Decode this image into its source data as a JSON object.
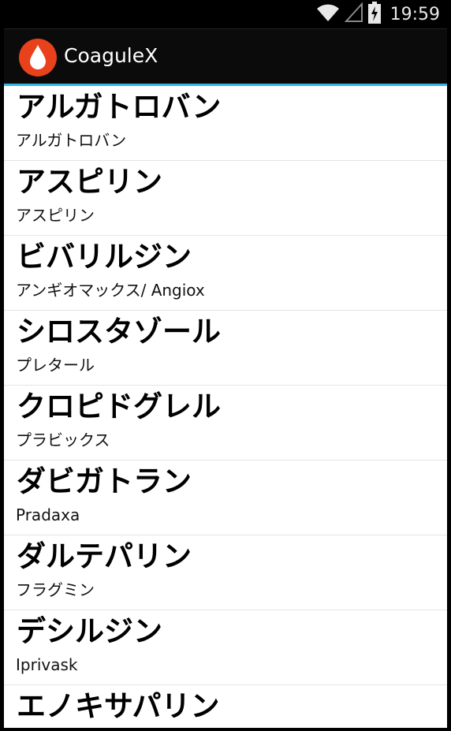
{
  "status_bar": {
    "time": "19:59",
    "icons": [
      "wifi-icon",
      "signal-icon",
      "battery-charging-icon"
    ]
  },
  "app_bar": {
    "title": "CoaguleX",
    "logo_icon": "blood-drop-icon",
    "accent_color": "#33b5e5",
    "logo_color": "#e8411c"
  },
  "drugs": [
    {
      "name": "アルガトロバン",
      "brand": "アルガトロバン"
    },
    {
      "name": "アスピリン",
      "brand": "アスピリン"
    },
    {
      "name": "ビバリルジン",
      "brand": "アンギオマックス/ Angiox"
    },
    {
      "name": "シロスタゾール",
      "brand": "プレタール"
    },
    {
      "name": "クロピドグレル",
      "brand": "プラビックス"
    },
    {
      "name": "ダビガトラン",
      "brand": "Pradaxa"
    },
    {
      "name": "ダルテパリン",
      "brand": "フラグミン"
    },
    {
      "name": "デシルジン",
      "brand": "Iprivask"
    },
    {
      "name": "エノキサパリン",
      "brand": ""
    }
  ]
}
